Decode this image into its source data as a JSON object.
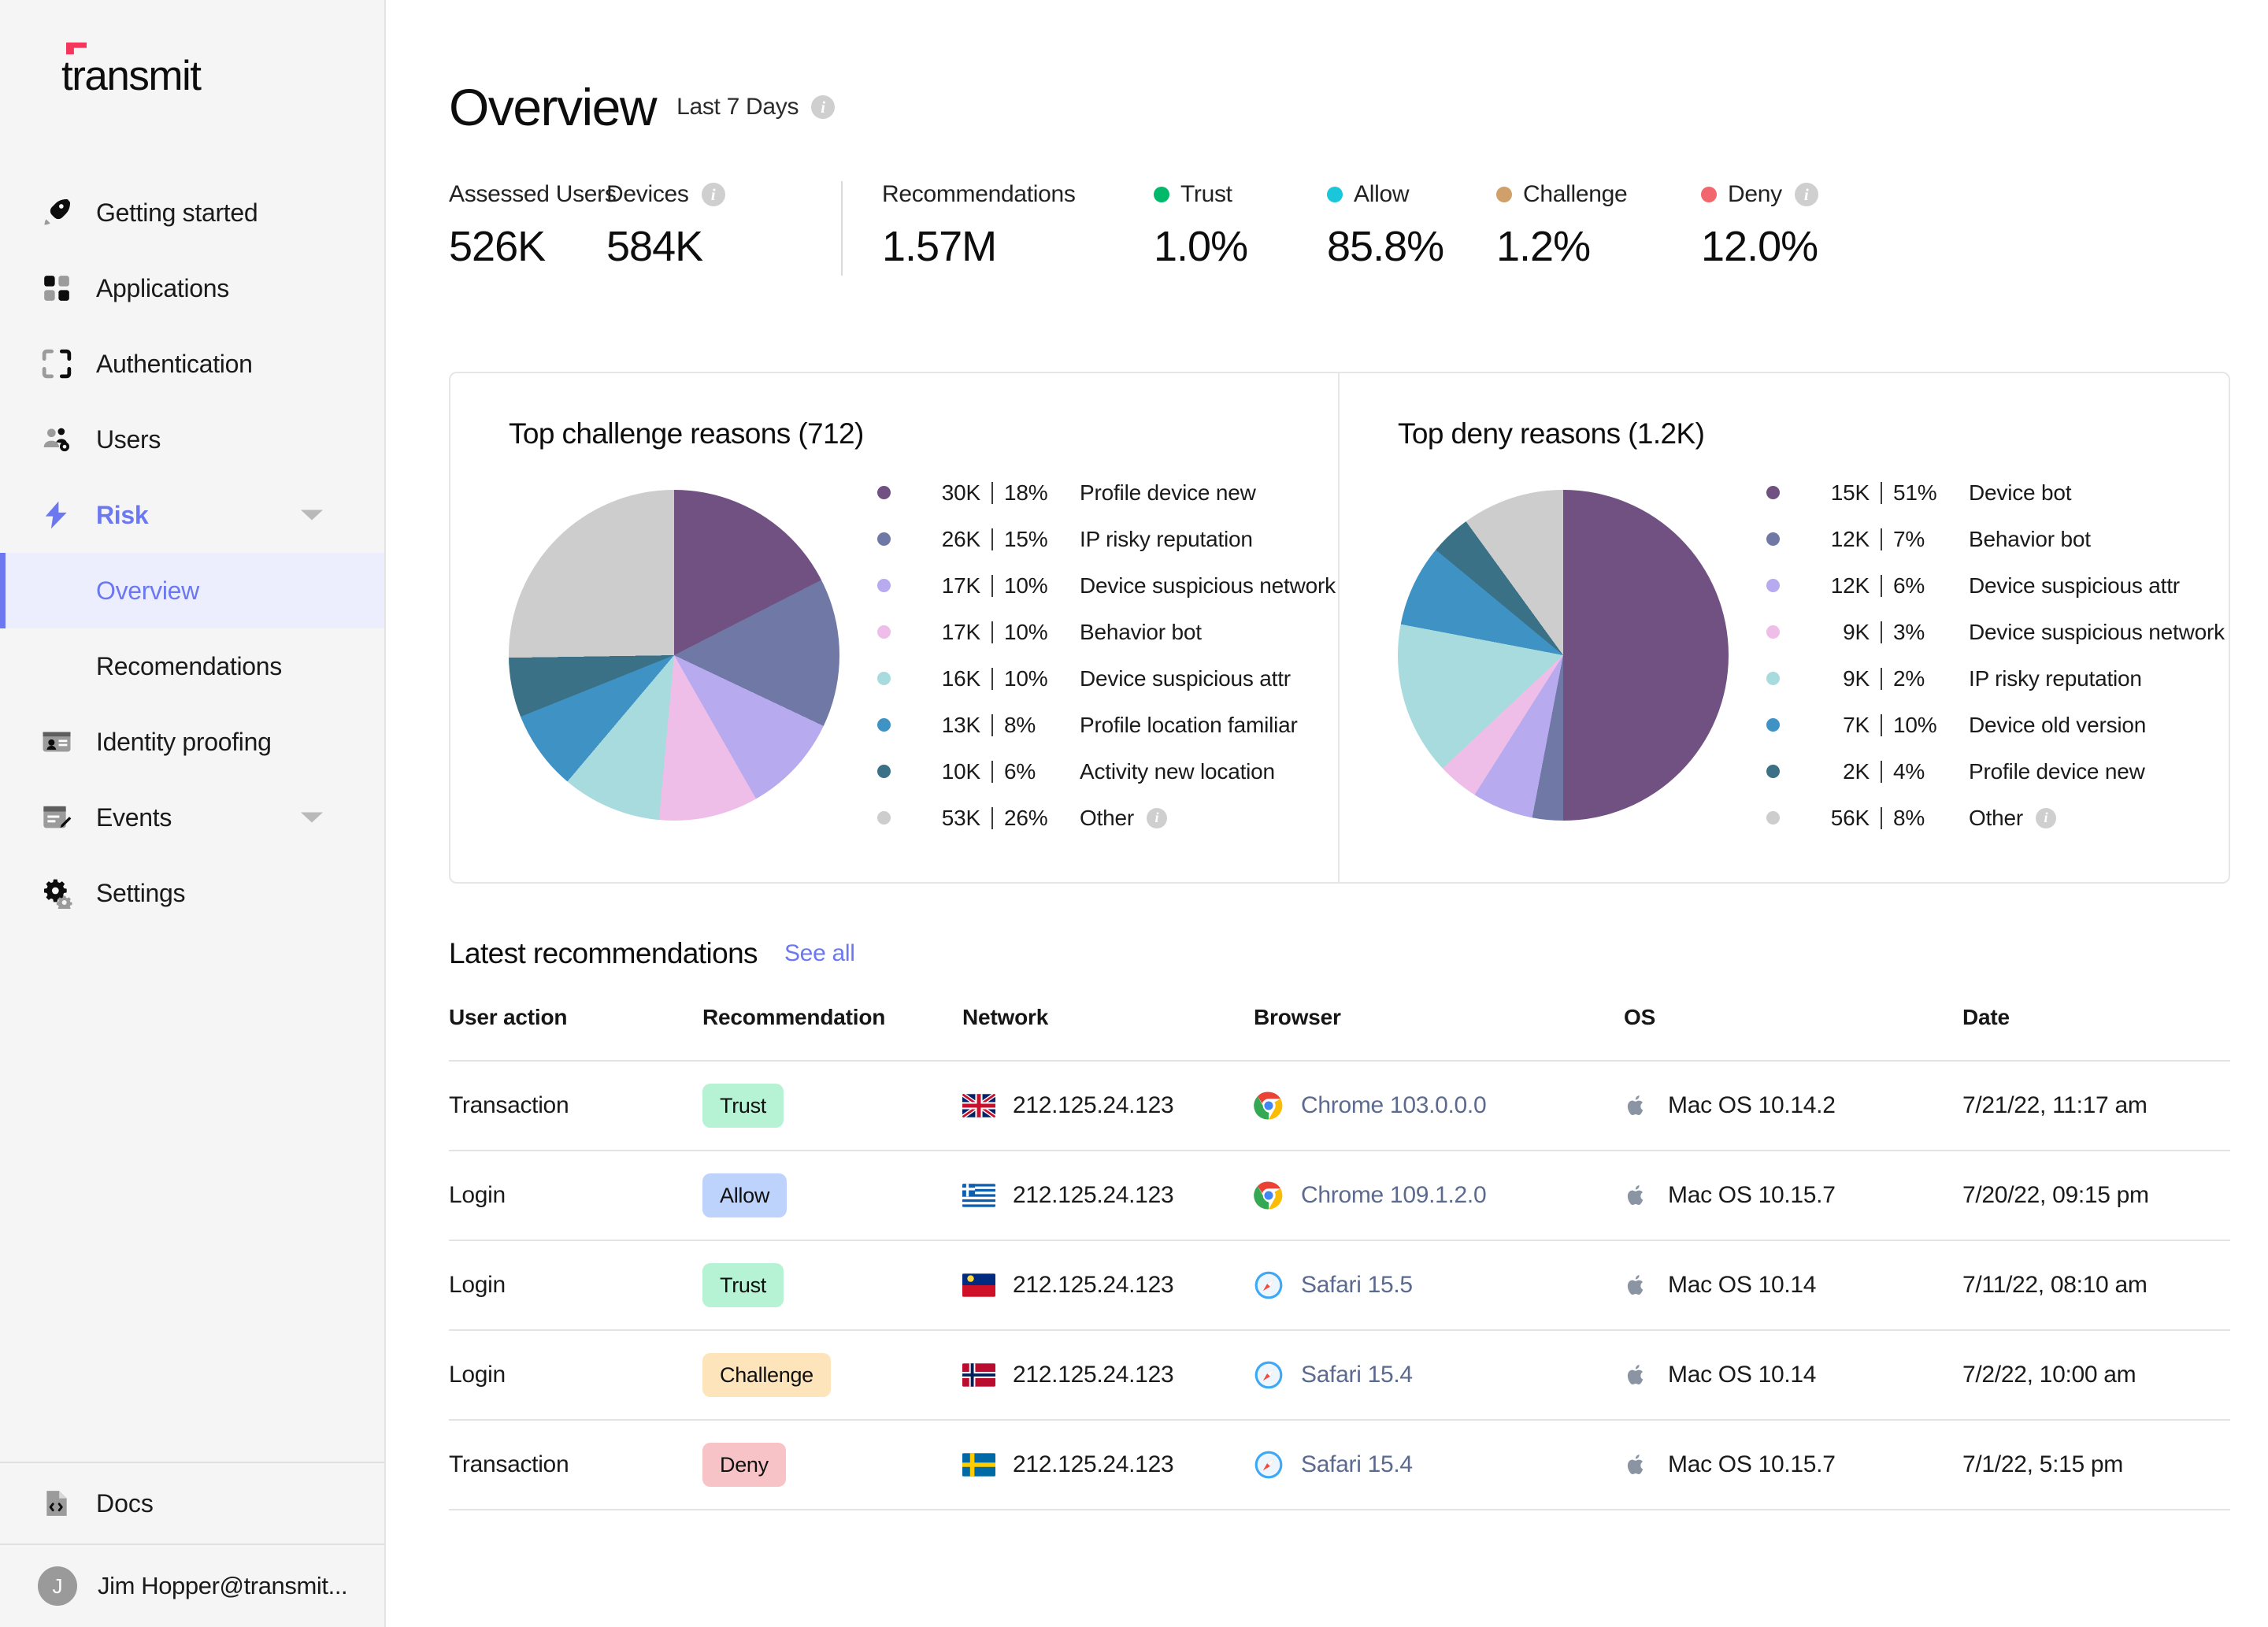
{
  "brand": {
    "name": "transmit"
  },
  "sidebar": {
    "items": [
      {
        "label": "Getting started",
        "icon": "rocket-icon",
        "type": "item"
      },
      {
        "label": "Applications",
        "icon": "grid-icon",
        "type": "item"
      },
      {
        "label": "Authentication",
        "icon": "scan-icon",
        "type": "item"
      },
      {
        "label": "Users",
        "icon": "users-icon",
        "type": "item"
      },
      {
        "label": "Risk",
        "icon": "bolt-icon",
        "type": "parent",
        "expanded": true,
        "active": true
      },
      {
        "label": "Overview",
        "type": "sub",
        "selected": true
      },
      {
        "label": "Recomendations",
        "type": "sub",
        "selected": false
      },
      {
        "label": "Identity proofing",
        "icon": "id-card-icon",
        "type": "item"
      },
      {
        "label": "Events",
        "icon": "calendar-edit-icon",
        "type": "parent",
        "expanded": false
      },
      {
        "label": "Settings",
        "icon": "gears-icon",
        "type": "item"
      }
    ],
    "docs": {
      "label": "Docs",
      "icon": "code-file-icon"
    },
    "user": {
      "label": "Jim Hopper@transmit...",
      "initial": "J"
    }
  },
  "header": {
    "title": "Overview",
    "range": "Last 7 Days",
    "info": "i"
  },
  "metrics": [
    {
      "label": "Assessed Users",
      "value": "526K",
      "dot": null,
      "info": false
    },
    {
      "label": "Devices",
      "value": "584K",
      "dot": null,
      "info": true
    },
    {
      "label": "Recommendations",
      "value": "1.57M",
      "dot": null,
      "info": false
    },
    {
      "label": "Trust",
      "value": "1.0%",
      "dot": "#00b96b",
      "info": false
    },
    {
      "label": "Allow",
      "value": "85.8%",
      "dot": "#1ac6d9",
      "info": false
    },
    {
      "label": "Challenge",
      "value": "1.2%",
      "dot": "#cfa06a",
      "info": false
    },
    {
      "label": "Deny",
      "value": "12.0%",
      "dot": "#f2666e",
      "info": true
    }
  ],
  "palette": {
    "c1": "#705182",
    "c2": "#7078a6",
    "c3": "#b7aaee",
    "c4": "#efbee8",
    "c5": "#a8dbde",
    "c6": "#3f92c4",
    "c7": "#3a7186",
    "other": "#cdcdcd"
  },
  "chart_data": [
    {
      "type": "pie",
      "title": "Top challenge  reasons (712)",
      "total_label": "712",
      "legend_position": "right",
      "categories": [
        "Profile device new",
        "IP risky reputation",
        "Device suspicious network",
        "Behavior bot",
        "Device suspicious attr",
        "Profile location familiar",
        "Activity new location",
        "Other"
      ],
      "values": [
        18,
        15,
        10,
        10,
        10,
        8,
        6,
        26
      ],
      "counts": [
        "30K",
        "26K",
        "17K",
        "17K",
        "16K",
        "13K",
        "10K",
        "53K"
      ],
      "percents": [
        "18%",
        "15%",
        "10%",
        "10%",
        "10%",
        "8%",
        "6%",
        "26%"
      ],
      "colors": [
        "#705182",
        "#7078a6",
        "#b7aaee",
        "#efbee8",
        "#a8dbde",
        "#3f92c4",
        "#3a7186",
        "#cdcdcd"
      ],
      "other_info": "i"
    },
    {
      "type": "pie",
      "title": "Top deny  reasons (1.2K)",
      "total_label": "1.2K",
      "legend_position": "right",
      "categories": [
        "Device bot",
        "Behavior bot",
        "Device suspicious attr",
        "Device suspicious network",
        "IP risky reputation",
        "Device old version",
        "Profile device new",
        "Other"
      ],
      "values": [
        51,
        7,
        6,
        3,
        2,
        10,
        4,
        8
      ],
      "slice_angles": [
        50,
        3,
        6,
        4,
        15,
        8,
        4,
        10
      ],
      "counts": [
        "15K",
        "12K",
        "12K",
        "9K",
        "9K",
        "7K",
        "2K",
        "56K"
      ],
      "percents": [
        "51%",
        "7%",
        "6%",
        "3%",
        "2%",
        "10%",
        "4%",
        "8%"
      ],
      "colors": [
        "#705182",
        "#7078a6",
        "#b7aaee",
        "#efbee8",
        "#a8dbde",
        "#3f92c4",
        "#3a7186",
        "#cdcdcd"
      ],
      "other_info": "i"
    }
  ],
  "table": {
    "title": "Latest recommendations",
    "see_all": "See all",
    "columns": [
      "User action",
      "Recommendation",
      "Network",
      "Browser",
      "OS",
      "Date"
    ],
    "rows": [
      {
        "action": "Transaction",
        "rec": "Trust",
        "rec_bg": "#b6f2d4",
        "flag": "gb",
        "ip": "212.125.24.123",
        "browser": "Chrome 103.0.0.0",
        "browser_icon": "chrome-icon",
        "os": "Mac OS 10.14.2",
        "os_icon": "apple-icon",
        "date": "7/21/22, 11:17 am"
      },
      {
        "action": "Login",
        "rec": "Allow",
        "rec_bg": "#bdd3fb",
        "flag": "gr",
        "ip": "212.125.24.123",
        "browser": "Chrome 109.1.2.0",
        "browser_icon": "chrome-icon",
        "os": "Mac OS 10.15.7",
        "os_icon": "apple-icon",
        "date": "7/20/22, 09:15 pm"
      },
      {
        "action": "Login",
        "rec": "Trust",
        "rec_bg": "#b6f2d4",
        "flag": "li",
        "ip": "212.125.24.123",
        "browser": "Safari 15.5",
        "browser_icon": "safari-icon",
        "os": "Mac OS 10.14",
        "os_icon": "apple-icon",
        "date": "7/11/22, 08:10 am"
      },
      {
        "action": "Login",
        "rec": "Challenge",
        "rec_bg": "#fde4bb",
        "flag": "no",
        "ip": "212.125.24.123",
        "browser": "Safari 15.4",
        "browser_icon": "safari-icon",
        "os": "Mac OS 10.14",
        "os_icon": "apple-icon",
        "date": "7/2/22, 10:00 am"
      },
      {
        "action": "Transaction",
        "rec": "Deny",
        "rec_bg": "#f8c3c6",
        "flag": "se",
        "ip": "212.125.24.123",
        "browser": "Safari 15.4",
        "browser_icon": "safari-icon",
        "os": "Mac OS 10.15.7",
        "os_icon": "apple-icon",
        "date": "7/1/22, 5:15 pm"
      }
    ]
  }
}
